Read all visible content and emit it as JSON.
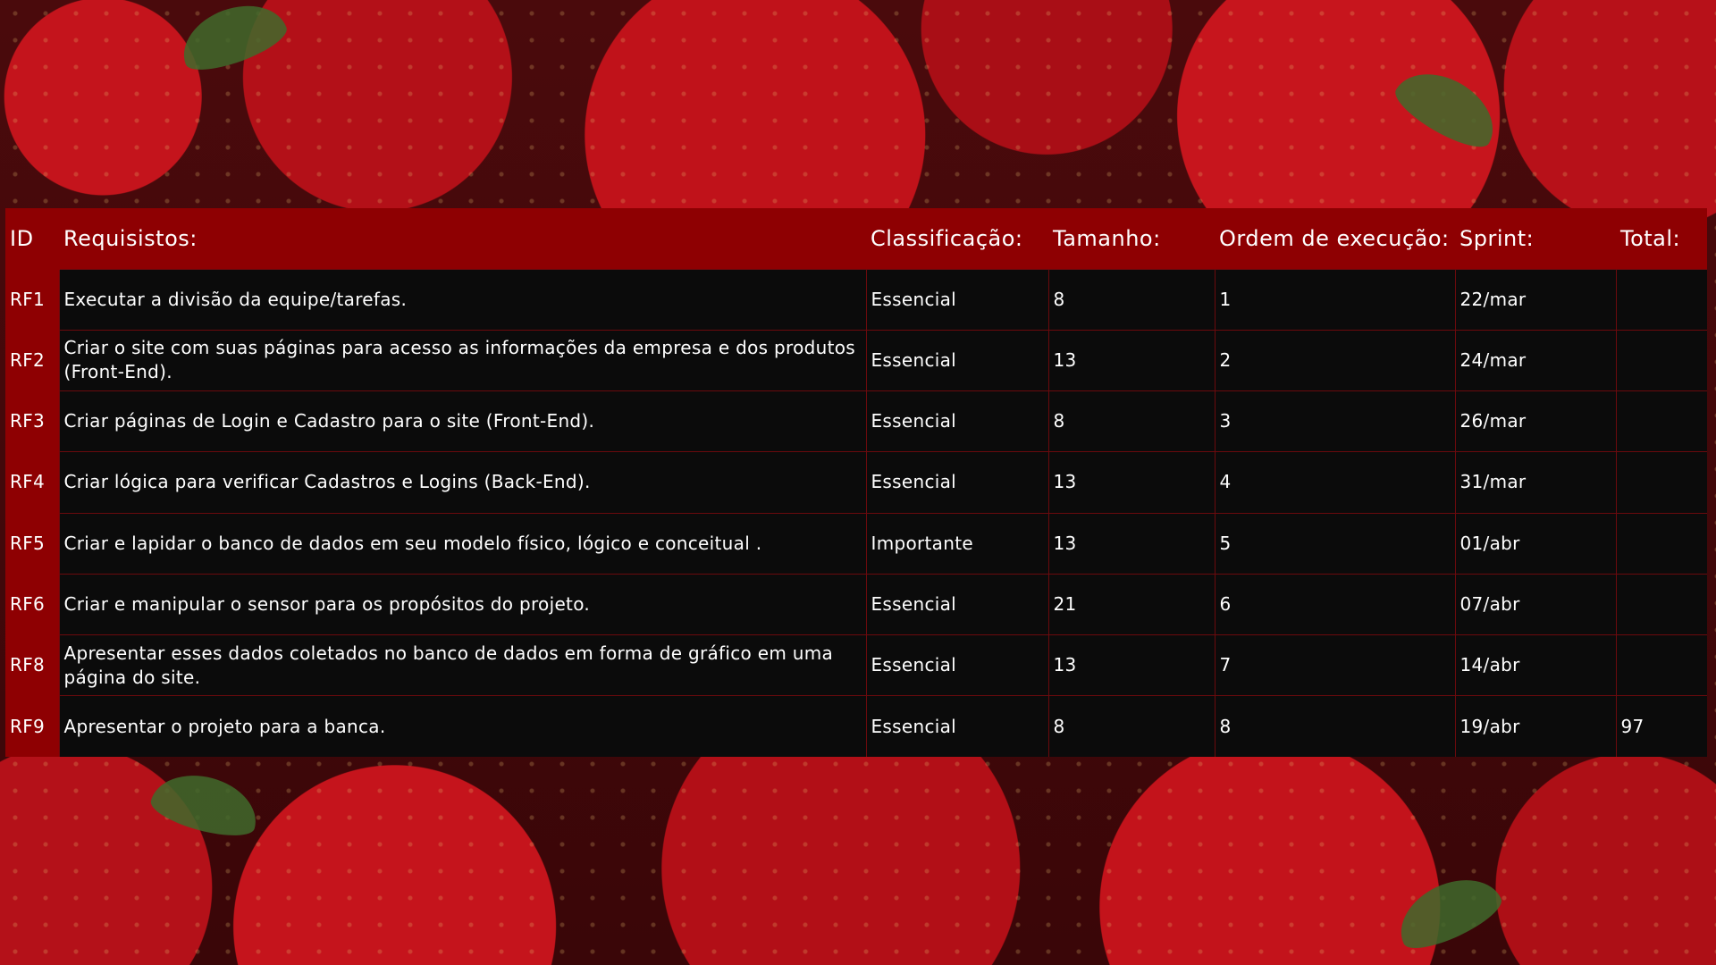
{
  "headers": {
    "id": "ID",
    "req": "Requisistos:",
    "class": "Classificação:",
    "size": "Tamanho:",
    "order": "Ordem de execução:",
    "sprint": "Sprint:",
    "total": "Total:"
  },
  "rows": [
    {
      "id": "RF1",
      "req": "Executar a divisão da equipe/tarefas.",
      "class": "Essencial",
      "size": "8",
      "order": "1",
      "sprint": "22/mar",
      "total": ""
    },
    {
      "id": "RF2",
      "req": "Criar o site com suas páginas para acesso as informações da empresa e dos produtos (Front-End).",
      "class": "Essencial",
      "size": "13",
      "order": "2",
      "sprint": "24/mar",
      "total": ""
    },
    {
      "id": "RF3",
      "req": "Criar páginas de Login e Cadastro para o site (Front-End).",
      "class": "Essencial",
      "size": "8",
      "order": "3",
      "sprint": "26/mar",
      "total": ""
    },
    {
      "id": "RF4",
      "req": "Criar lógica para verificar Cadastros e Logins (Back-End).",
      "class": "Essencial",
      "size": "13",
      "order": "4",
      "sprint": "31/mar",
      "total": ""
    },
    {
      "id": "RF5",
      "req": "Criar e lapidar o banco de dados em seu modelo físico, lógico e conceitual .",
      "class": "Importante",
      "size": "13",
      "order": "5",
      "sprint": "01/abr",
      "total": ""
    },
    {
      "id": "RF6",
      "req": "Criar e manipular o sensor para os propósitos do projeto.",
      "class": "Essencial",
      "size": "21",
      "order": "6",
      "sprint": "07/abr",
      "total": ""
    },
    {
      "id": "RF8",
      "req": "Apresentar esses dados coletados no banco de dados em forma de gráfico em uma página do site.",
      "class": "Essencial",
      "size": "13",
      "order": "7",
      "sprint": "14/abr",
      "total": ""
    },
    {
      "id": "RF9",
      "req": "Apresentar o projeto para a banca.",
      "class": "Essencial",
      "size": "8",
      "order": "8",
      "sprint": "19/abr",
      "total": "97"
    }
  ],
  "colors": {
    "header_bg": "#8e0002",
    "body_bg": "#0b0b0b",
    "grid": "#6b0a0d"
  }
}
